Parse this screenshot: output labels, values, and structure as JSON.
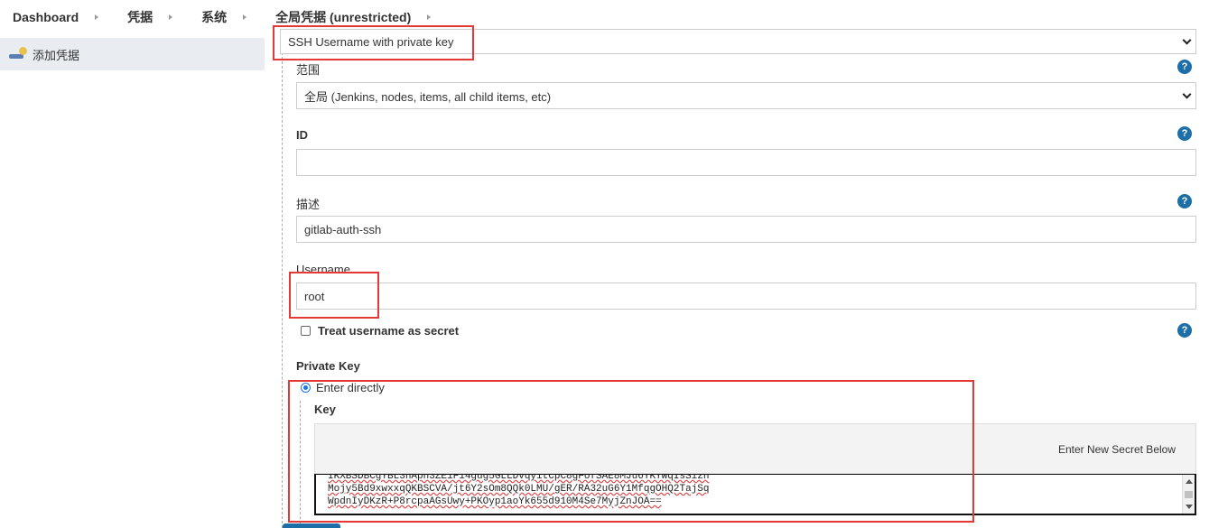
{
  "breadcrumb": [
    "Dashboard",
    "凭据",
    "系统",
    "全局凭据 (unrestricted)"
  ],
  "sidebar": {
    "items": [
      {
        "label": "添加凭据",
        "icon": "credentials-icon"
      }
    ]
  },
  "form": {
    "kind_value": "SSH Username with private key",
    "scope_label": "范围",
    "scope_value": "全局 (Jenkins, nodes, items, all child items, etc)",
    "id_label": "ID",
    "id_value": "",
    "description_label": "描述",
    "description_value": "gitlab-auth-ssh",
    "username_label": "Username",
    "username_value": "root",
    "treat_secret_label": "Treat username as secret",
    "treat_secret_checked": false,
    "private_key_label": "Private Key",
    "enter_directly_label": "Enter directly",
    "key_label": "Key",
    "secret_hint": "Enter New Secret Below",
    "key_lines": [
      "IKXBSDBCgYBL3hApn3ZE1F14gug5GLLDvqyitCpC8gFofSAE8MJu6YKYWqIsSizn",
      "Mojy5Bd9xwxxqQKBSCVA/jt6Y2sOm8QQk0LMU/gER/RA32uG6Y1MfqgOHQ2TajSq",
      "WpdnIyDKzR+P8rcpaAGsUwy+PKOyp1aoYk655d910M4Se7MyjZnJOA=="
    ],
    "help_symbol": "?"
  },
  "colors": {
    "accent": "#1e6fa8",
    "highlight": "#e53935",
    "sidebar_active": "#e9edf2"
  }
}
